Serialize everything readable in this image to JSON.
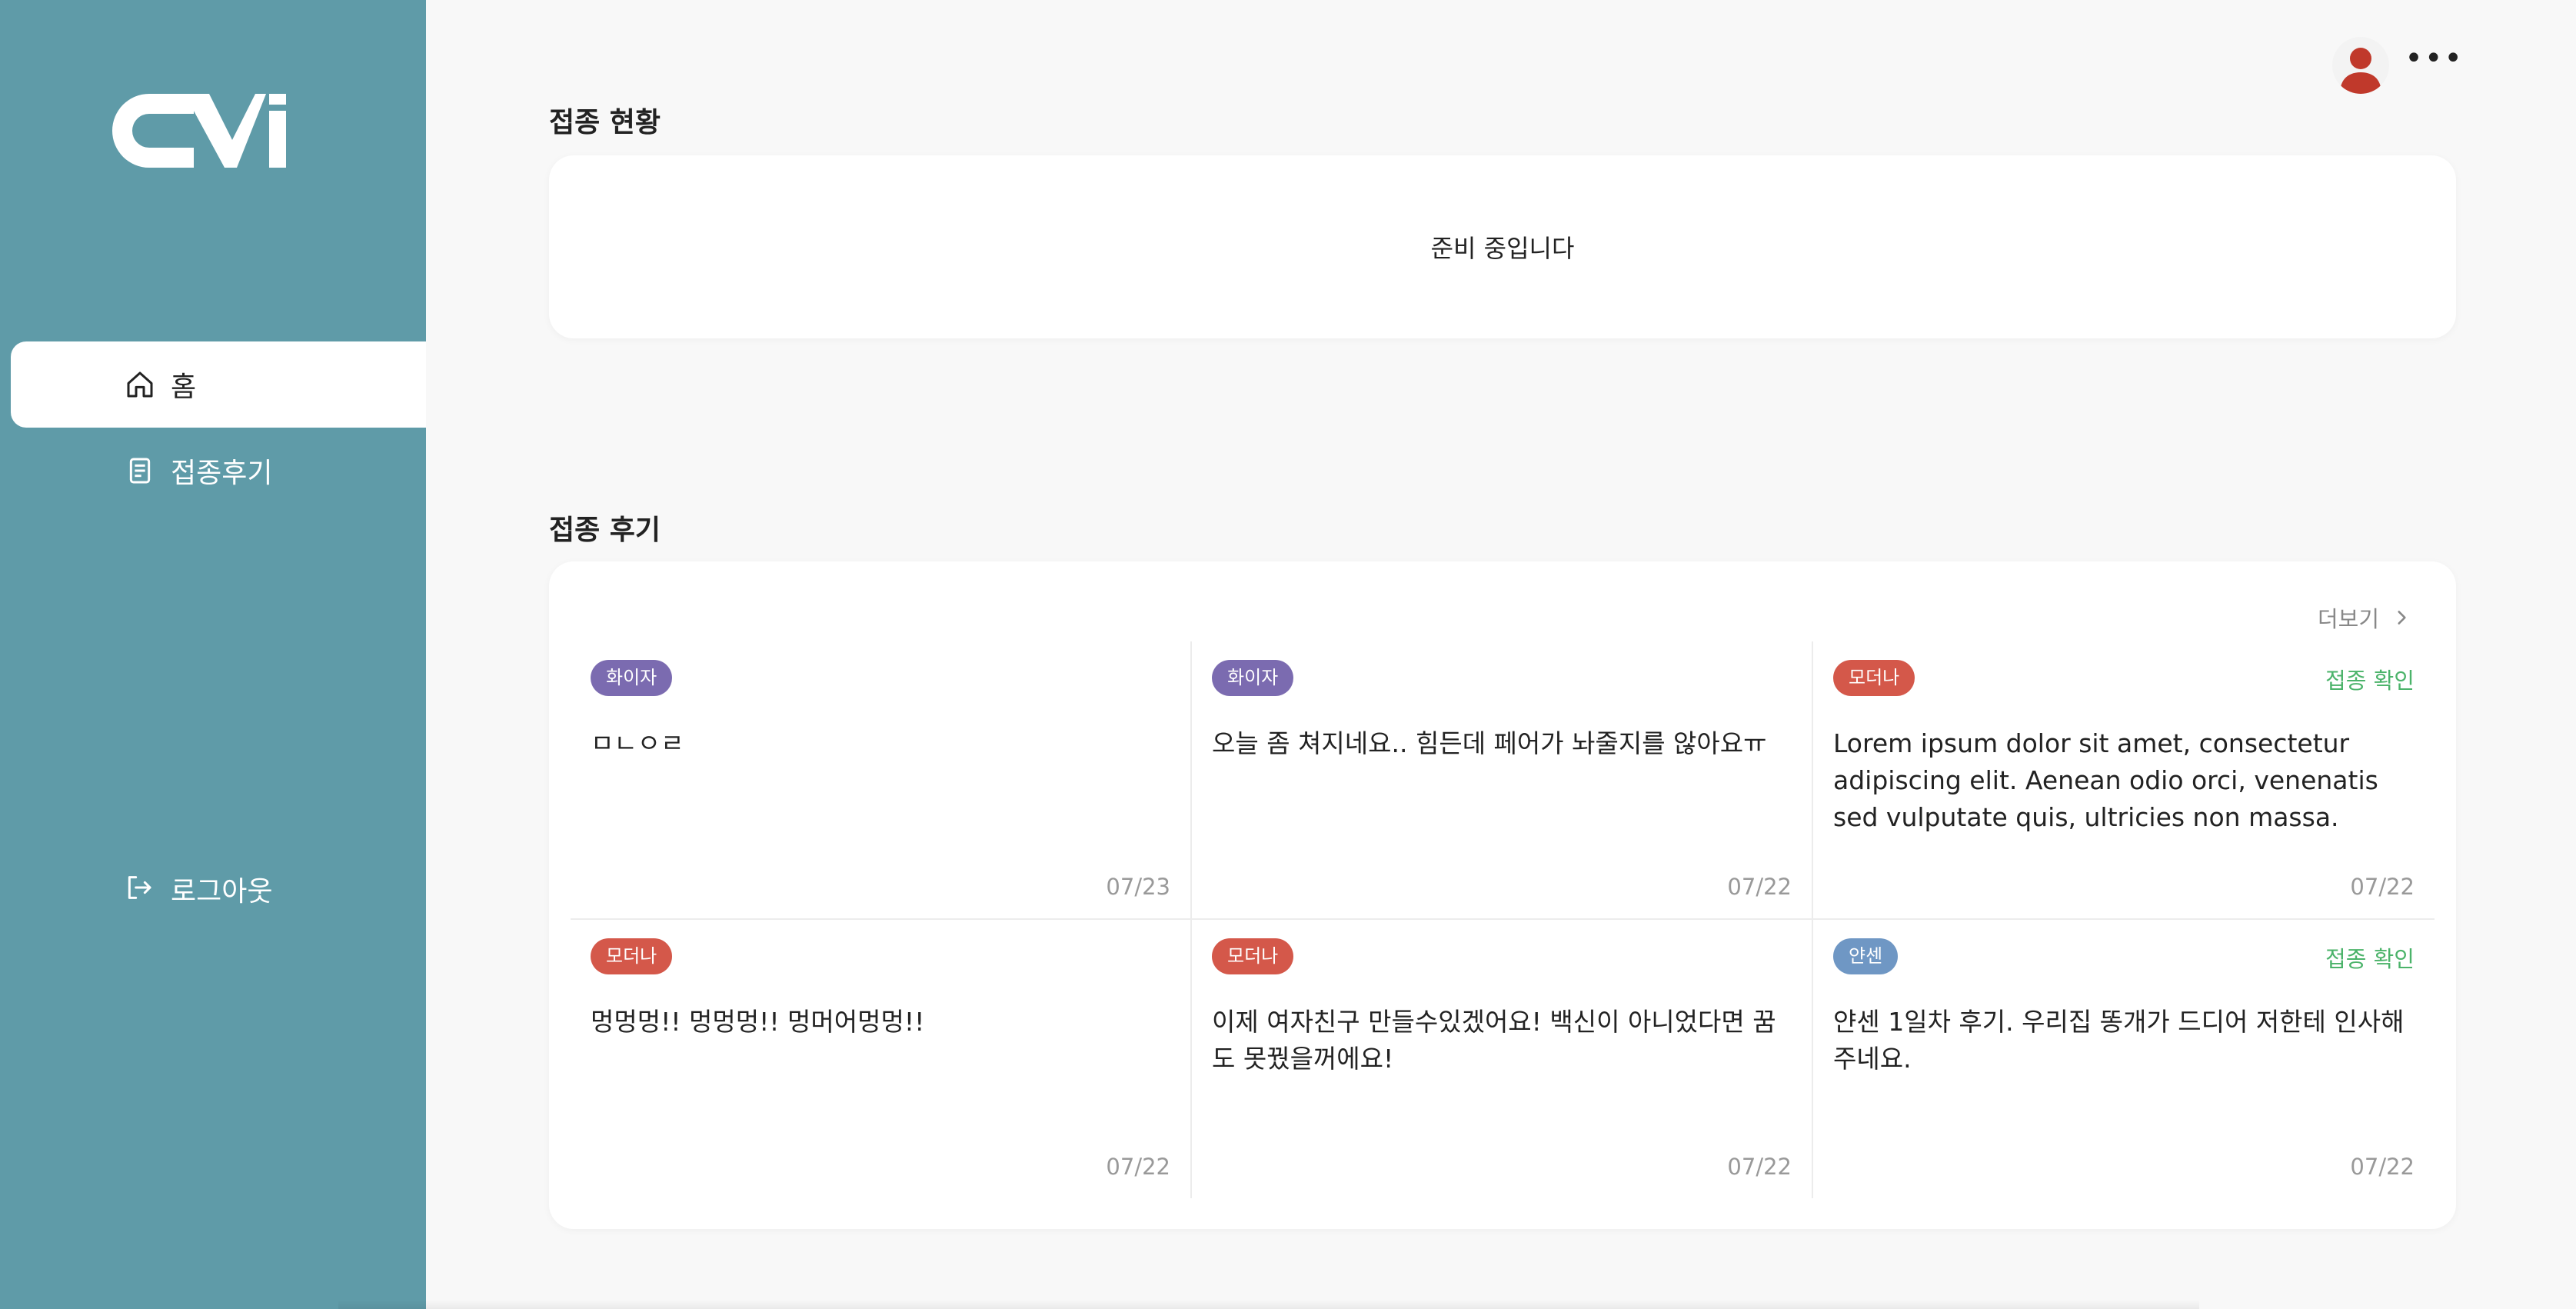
{
  "sidebar": {
    "logo_icon": "cvi-logo",
    "items": [
      {
        "label": "홈",
        "icon": "home-icon",
        "active": true
      },
      {
        "label": "접종후기",
        "icon": "document-icon",
        "active": false
      }
    ],
    "logout_label": "로그아웃",
    "bg_color": "#5f9ba8"
  },
  "topbar": {
    "avatar_icon": "user-avatar-icon",
    "more_label": "•••"
  },
  "status_section": {
    "title": "접종 현황",
    "message": "준비 중입니다"
  },
  "review_section": {
    "title": "접종 후기",
    "more_label": "더보기",
    "reviews": [
      {
        "badge": "화이자",
        "badge_color": "#7b6bb0",
        "verified": "",
        "text": "ㅁㄴㅇㄹ",
        "date": "07/23"
      },
      {
        "badge": "화이자",
        "badge_color": "#7b6bb0",
        "verified": "",
        "text": "오늘 좀 쳐지네요.. 힘든데 페어가 놔줄지를 않아요ㅠ",
        "date": "07/22"
      },
      {
        "badge": "모더나",
        "badge_color": "#d4584a",
        "verified": "접종 확인",
        "text": "Lorem ipsum dolor sit amet, consectetur adipiscing elit. Aenean odio orci, venenatis sed vulputate quis, ultricies non massa. Nulla...",
        "date": "07/22"
      },
      {
        "badge": "모더나",
        "badge_color": "#d4584a",
        "verified": "",
        "text": "멍멍멍!! 멍멍멍!! 멍머어멍멍!!",
        "date": "07/22"
      },
      {
        "badge": "모더나",
        "badge_color": "#d4584a",
        "verified": "",
        "text": "이제 여자친구 만들수있겠어요! 백신이 아니었다면 꿈도 못꿨을꺼에요!",
        "date": "07/22"
      },
      {
        "badge": "얀센",
        "badge_color": "#6f97c4",
        "verified": "접종 확인",
        "text": "얀센 1일차 후기. 우리집 똥개가 드디어 저한테 인사해주네요.",
        "date": "07/22"
      }
    ],
    "verified_color": "#4bb36a"
  }
}
